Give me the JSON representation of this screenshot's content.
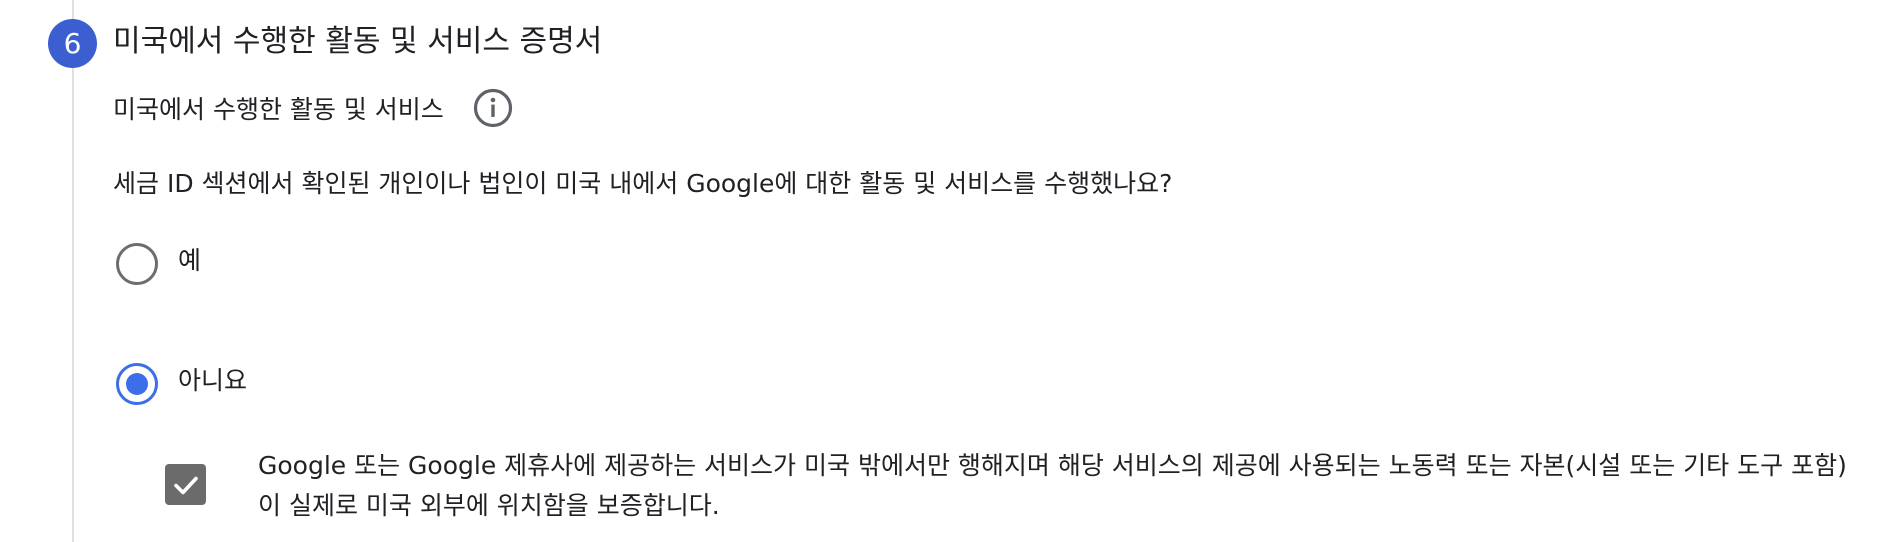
{
  "step": {
    "number": "6",
    "title": "미국에서 수행한 활동 및 서비스 증명서"
  },
  "subsection": {
    "title": "미국에서 수행한 활동 및 서비스"
  },
  "question": "세금 ID 섹션에서 확인된 개인이나 법인이 미국 내에서 Google에 대한 활동 및 서비스를 수행했나요?",
  "options": [
    {
      "label": "예",
      "selected": false
    },
    {
      "label": "아니요",
      "selected": true
    }
  ],
  "certification": {
    "checked": true,
    "text": "Google 또는 Google 제휴사에 제공하는 서비스가 미국 밖에서만 행해지며 해당 서비스의 제공에 사용되는 노동력 또는 자본(시설 또는 기타 도구 포함)이 실제로 미국 외부에 위치함을 보증합니다."
  },
  "icons": {
    "info": "info-icon",
    "check": "checkmark-icon"
  },
  "colors": {
    "step_badge": "#3b5fd1",
    "radio_selected": "#3b6ee8",
    "checkbox_fill": "#6b6b6b",
    "text": "#202124"
  }
}
